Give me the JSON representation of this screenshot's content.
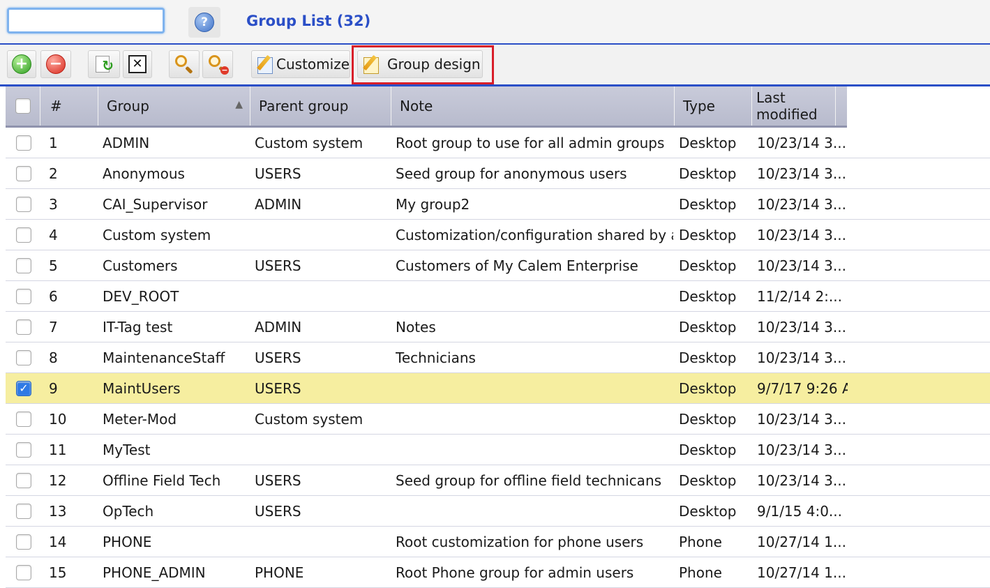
{
  "header": {
    "search_value": "",
    "help_icon": "?",
    "title": "Group List (32)"
  },
  "toolbar": {
    "add_icon": "+",
    "delete_icon": "−",
    "refresh_icon": "↻",
    "clear_icon": "✕",
    "customize_label": "Customize",
    "group_design_label": "Group design"
  },
  "grid": {
    "columns": [
      "#",
      "Group",
      "Parent group",
      "Note",
      "Type",
      "Last modified"
    ],
    "sort_indicator": "▲",
    "rows": [
      {
        "num": "1",
        "group": "ADMIN",
        "parent": "Custom system",
        "note": "Root group to use for all admin groups",
        "type": "Desktop",
        "modified": "10/23/14 3...",
        "checked": false
      },
      {
        "num": "2",
        "group": "Anonymous",
        "parent": "USERS",
        "note": "Seed group for anonymous users",
        "type": "Desktop",
        "modified": "10/23/14 3...",
        "checked": false
      },
      {
        "num": "3",
        "group": "CAI_Supervisor",
        "parent": "ADMIN",
        "note": "My group2",
        "type": "Desktop",
        "modified": "10/23/14 3...",
        "checked": false
      },
      {
        "num": "4",
        "group": "Custom system",
        "parent": "",
        "note": "Customization/configuration shared by a...",
        "type": "Desktop",
        "modified": "10/23/14 3...",
        "checked": false
      },
      {
        "num": "5",
        "group": "Customers",
        "parent": "USERS",
        "note": "Customers of My Calem Enterprise",
        "type": "Desktop",
        "modified": "10/23/14 3...",
        "checked": false
      },
      {
        "num": "6",
        "group": "DEV_ROOT",
        "parent": "",
        "note": "",
        "type": "Desktop",
        "modified": "11/2/14 2:...",
        "checked": false
      },
      {
        "num": "7",
        "group": "IT-Tag test",
        "parent": "ADMIN",
        "note": "Notes",
        "type": "Desktop",
        "modified": "10/23/14 3...",
        "checked": false
      },
      {
        "num": "8",
        "group": "MaintenanceStaff",
        "parent": "USERS",
        "note": "Technicians",
        "type": "Desktop",
        "modified": "10/23/14 3...",
        "checked": false
      },
      {
        "num": "9",
        "group": "MaintUsers",
        "parent": "USERS",
        "note": "",
        "type": "Desktop",
        "modified": "9/7/17 9:26 A",
        "checked": true
      },
      {
        "num": "10",
        "group": "Meter-Mod",
        "parent": "Custom system",
        "note": "",
        "type": "Desktop",
        "modified": "10/23/14 3...",
        "checked": false
      },
      {
        "num": "11",
        "group": "MyTest",
        "parent": "",
        "note": "",
        "type": "Desktop",
        "modified": "10/23/14 3...",
        "checked": false
      },
      {
        "num": "12",
        "group": "Offline Field Tech",
        "parent": "USERS",
        "note": "Seed group for offline field technicans",
        "type": "Desktop",
        "modified": "10/23/14 3...",
        "checked": false
      },
      {
        "num": "13",
        "group": "OpTech",
        "parent": "USERS",
        "note": "",
        "type": "Desktop",
        "modified": "9/1/15 4:0...",
        "checked": false
      },
      {
        "num": "14",
        "group": "PHONE",
        "parent": "",
        "note": "Root customization for phone users",
        "type": "Phone",
        "modified": "10/27/14 1...",
        "checked": false
      },
      {
        "num": "15",
        "group": "PHONE_ADMIN",
        "parent": "PHONE",
        "note": "Root Phone group for admin users",
        "type": "Phone",
        "modified": "10/27/14 1...",
        "checked": false
      }
    ]
  },
  "colors": {
    "accent": "#2b4fc7",
    "selected_row": "#f6eea0",
    "highlight_box": "#d81e2a",
    "header_bg": "#c9cbda"
  }
}
